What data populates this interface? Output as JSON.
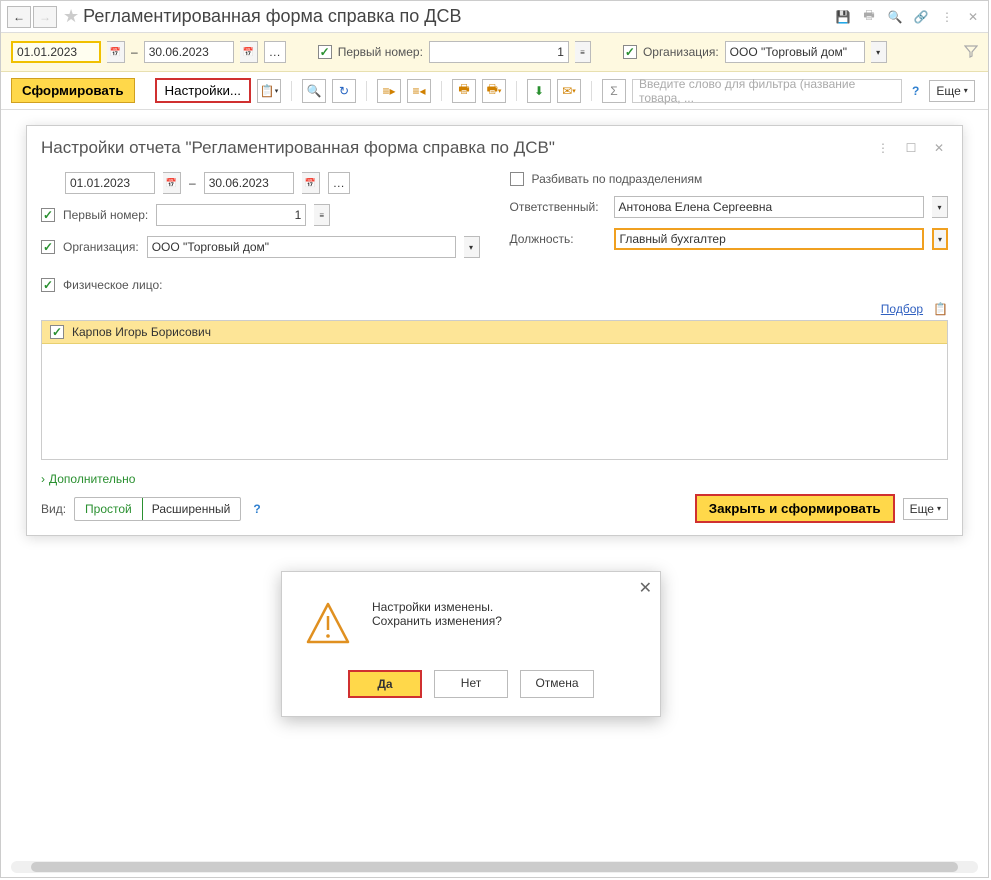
{
  "window": {
    "title": "Регламентированная форма справка по ДСВ"
  },
  "filter": {
    "date_from": "01.01.2023",
    "date_to": "30.06.2023",
    "first_number_label": "Первый номер:",
    "first_number_value": "1",
    "org_label": "Организация:",
    "org_value": "ООО \"Торговый дом\""
  },
  "toolbar": {
    "generate": "Сформировать",
    "settings": "Настройки...",
    "search_placeholder": "Введите слово для фильтра (название товара, ...",
    "more": "Еще"
  },
  "settings_dialog": {
    "title": "Настройки отчета \"Регламентированная форма справка по ДСВ\"",
    "date_from": "01.01.2023",
    "date_to": "30.06.2023",
    "first_number_label": "Первый номер:",
    "first_number_value": "1",
    "org_label": "Организация:",
    "org_value": "ООО \"Торговый дом\"",
    "split_label": "Разбивать по подразделениям",
    "responsible_label": "Ответственный:",
    "responsible_value": "Антонова Елена Сергеевна",
    "position_label": "Должность:",
    "position_value": "Главный бухгалтер",
    "person_label": "Физическое лицо:",
    "pick": "Подбор",
    "persons": [
      "Карпов Игорь Борисович"
    ],
    "additional": "Дополнительно",
    "mode_label": "Вид:",
    "mode_simple": "Простой",
    "mode_advanced": "Расширенный",
    "close_generate": "Закрыть и сформировать",
    "more": "Еще"
  },
  "confirm": {
    "line1": "Настройки изменены.",
    "line2": "Сохранить изменения?",
    "yes": "Да",
    "no": "Нет",
    "cancel": "Отмена"
  }
}
